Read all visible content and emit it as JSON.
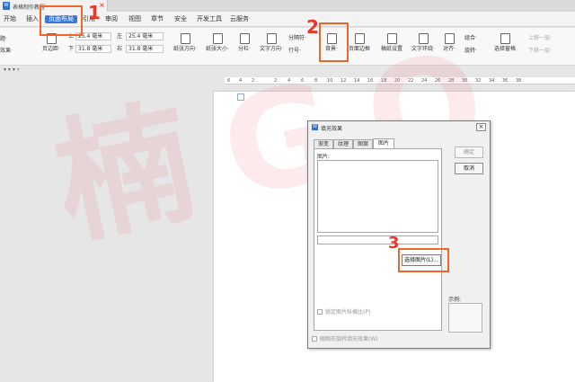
{
  "doc_tab": {
    "icon": "W",
    "title": "表格制作教程",
    "close": "×"
  },
  "menu": [
    "开始",
    "插入",
    "页面布局",
    "引用",
    "审阅",
    "视图",
    "章节",
    "安全",
    "开发工具",
    "云服务"
  ],
  "ribbon": {
    "left_edge": [
      "题·",
      "效果·"
    ],
    "margin_label": "页边距·",
    "margin_top_label": "上",
    "margin_top_value": "25.4 毫米",
    "margin_bottom_label": "下",
    "margin_bottom_value": "31.8 毫米",
    "margin_left_label": "左",
    "margin_left_value": "25.4 毫米",
    "margin_right_label": "右",
    "margin_right_value": "31.8 毫米",
    "orientation_label": "纸张方向·",
    "paper_size_label": "纸张大小·",
    "columns_label": "分栏·",
    "text_direction_label": "文字方向·",
    "separator_label": "分隔符·",
    "line_numbers_label": "行号·",
    "background_label": "背景·",
    "page_border_label": "页面边框",
    "draft_label": "稿纸设置",
    "text_wrap_label": "文字环绕·",
    "align_label": "对齐·",
    "group_label": "组合·",
    "rotate_label": "旋转·",
    "selection_pane_label": "选择窗格",
    "bring_forward_label": "上移一层·",
    "send_backward_label": "下移一层·"
  },
  "quick_row": "▾ ▾ ▾ ▿",
  "ruler_numbers": [
    "6",
    "4",
    "2",
    "2",
    "4",
    "6",
    "8",
    "10",
    "12",
    "14",
    "16",
    "18",
    "20",
    "22",
    "24",
    "26",
    "28",
    "30",
    "32",
    "34",
    "36",
    "38"
  ],
  "watermark": "楠GO",
  "dialog": {
    "icon": "W",
    "title": "填充效果",
    "close": "×",
    "tabs": [
      "渐变",
      "纹理",
      "图案",
      "图片"
    ],
    "panel_label": "图片:",
    "file_value": "",
    "select_button": "选择图片(L)...",
    "lock_aspect": "锁定图片纵横比(P)",
    "rotate_with_shape": "随图形旋转填充效果(W)",
    "ok_button": "确定",
    "cancel_button": "取消",
    "preview_label": "示例:"
  },
  "callouts": [
    "1",
    "2",
    "3"
  ],
  "callout_color": "#f0652a",
  "accent_color": "#3a78d6"
}
